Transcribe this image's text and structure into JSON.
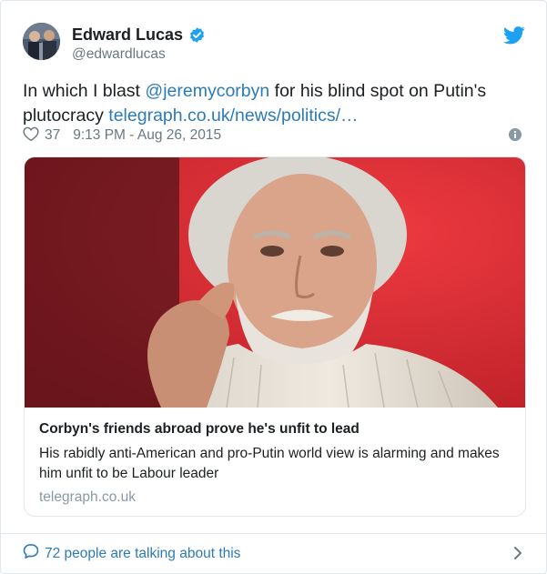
{
  "author": {
    "name": "Edward Lucas",
    "handle": "@edwardlucas"
  },
  "tweet": {
    "text_before": "In which I blast ",
    "mention": "@jeremycorbyn",
    "text_middle": " for his blind spot on Putin's plutocracy ",
    "link": "telegraph.co.uk/news/politics/…"
  },
  "meta": {
    "likes": "37",
    "timestamp": "9:13 PM - Aug 26, 2015"
  },
  "card": {
    "title": "Corbyn's friends abroad prove he's unfit to lead",
    "description": "His rabidly anti-American and pro-Putin world view is alarming and makes him unfit to be Labour leader",
    "domain": "telegraph.co.uk"
  },
  "footer": {
    "talking": "72 people are talking about this"
  },
  "colors": {
    "link": "#2b7bb9",
    "verified": "#1da1f2",
    "muted": "#697882",
    "photo_bg": "#e3343b"
  },
  "icons": [
    "verified-badge-icon",
    "twitter-bird-icon",
    "heart-icon",
    "info-icon",
    "speech-bubble-icon",
    "chevron-right-icon"
  ]
}
